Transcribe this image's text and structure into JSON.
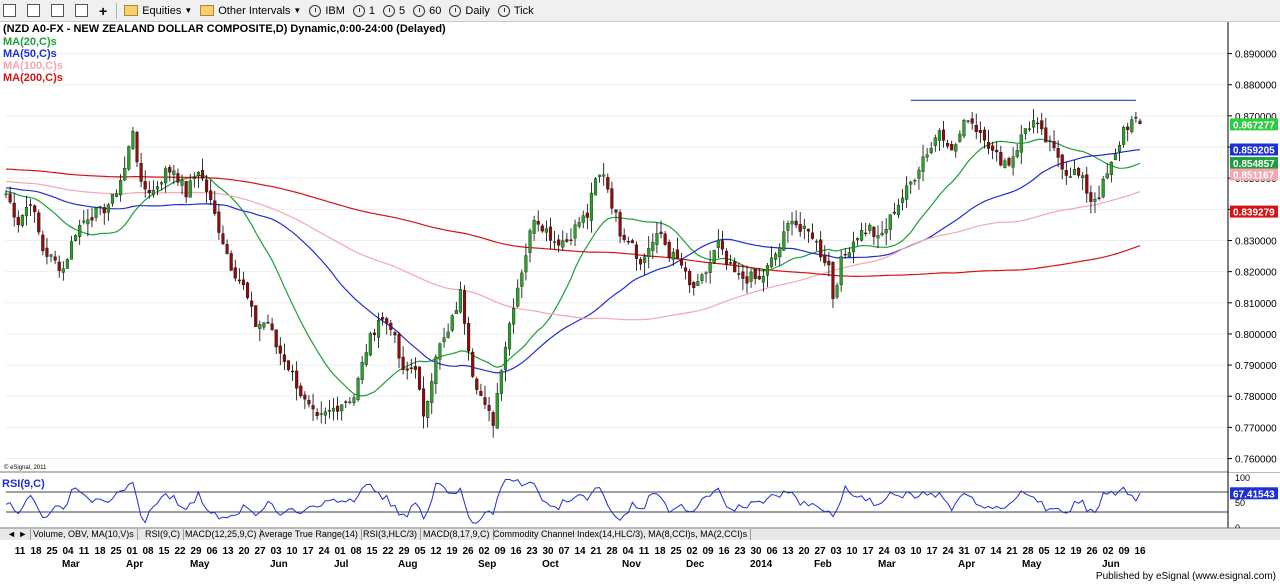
{
  "toolbar": {
    "items": [
      {
        "name": "pan-tool-icon"
      },
      {
        "name": "zoom-tool-icon"
      },
      {
        "name": "print-icon"
      },
      {
        "name": "properties-icon"
      },
      {
        "name": "crosshair-icon"
      }
    ],
    "equities_label": "Equities",
    "other_intervals_label": "Other Intervals",
    "intervals": [
      "IBM",
      "1",
      "5",
      "60",
      "Daily",
      "Tick"
    ]
  },
  "chart_header": {
    "title": "(NZD A0-FX - NEW ZEALAND DOLLAR COMPOSITE,D) Dynamic,0:00-24:00 (Delayed)",
    "studies": [
      {
        "label": "MA(20,C)s",
        "color": "#1e9e3c"
      },
      {
        "label": "MA(50,C)s",
        "color": "#1f2fd1"
      },
      {
        "label": "MA(100,C)s",
        "color": "#f4a7b2"
      },
      {
        "label": "MA(200,C)s",
        "color": "#d41414"
      }
    ],
    "copyright": "© eSignal, 2011"
  },
  "chart_data": {
    "type": "candlestick",
    "title": "(NZD A0-FX - NEW ZEALAND DOLLAR COMPOSITE,D) Dynamic,0:00-24:00 (Delayed)",
    "ylim": [
      0.756,
      0.895
    ],
    "y_ticks": [
      "0.890000",
      "0.880000",
      "0.870000",
      "0.860000",
      "0.850000",
      "0.840000",
      "0.830000",
      "0.820000",
      "0.810000",
      "0.800000",
      "0.790000",
      "0.780000",
      "0.770000",
      "0.760000"
    ],
    "price_flags": [
      {
        "label": "0.867277",
        "value": 0.867277,
        "color": "#2ecc40",
        "text_color": "#ffffff"
      },
      {
        "label": "0.859205",
        "value": 0.859205,
        "color": "#1f2fd1",
        "text_color": "#ffffff"
      },
      {
        "label": "0.854857",
        "value": 0.854857,
        "color": "#1e9e3c",
        "text_color": "#ffffff"
      },
      {
        "label": "0.851167",
        "value": 0.851167,
        "color": "#f4a7b2",
        "text_color": "#ffffff"
      },
      {
        "label": "0.839279",
        "value": 0.839279,
        "color": "#d41414",
        "text_color": "#ffffff"
      }
    ],
    "resistance_line": {
      "value": 0.875,
      "from_index": 221,
      "to_index": 276,
      "color": "#3040c0"
    },
    "x_day_labels": [
      "11",
      "18",
      "25",
      "04",
      "11",
      "18",
      "25",
      "01",
      "08",
      "15",
      "22",
      "29",
      "06",
      "13",
      "20",
      "27",
      "03",
      "10",
      "17",
      "24",
      "01",
      "08",
      "15",
      "22",
      "29",
      "05",
      "12",
      "19",
      "26",
      "02",
      "09",
      "16",
      "23",
      "30",
      "07",
      "14",
      "21",
      "28",
      "04",
      "11",
      "18",
      "25",
      "02",
      "09",
      "16",
      "23",
      "30",
      "06",
      "13",
      "20",
      "27",
      "03",
      "10",
      "17",
      "24",
      "03",
      "10",
      "17",
      "24",
      "31",
      "07",
      "14",
      "21",
      "28",
      "05",
      "12",
      "19",
      "26",
      "02",
      "09",
      "16"
    ],
    "x_month_labels": [
      {
        "label": "Mar",
        "index": 3
      },
      {
        "label": "Apr",
        "index": 7
      },
      {
        "label": "May",
        "index": 11
      },
      {
        "label": "Jun",
        "index": 16
      },
      {
        "label": "Jul",
        "index": 20
      },
      {
        "label": "Aug",
        "index": 24
      },
      {
        "label": "Sep",
        "index": 29
      },
      {
        "label": "Oct",
        "index": 33
      },
      {
        "label": "Nov",
        "index": 38
      },
      {
        "label": "Dec",
        "index": 42
      },
      {
        "label": "2014",
        "index": 46
      },
      {
        "label": "Feb",
        "index": 50
      },
      {
        "label": "Mar",
        "index": 54
      },
      {
        "label": "Apr",
        "index": 59
      },
      {
        "label": "May",
        "index": 63
      },
      {
        "label": "Jun",
        "index": 68
      }
    ],
    "close_anchors": [
      [
        0,
        0.845
      ],
      [
        3,
        0.836
      ],
      [
        6,
        0.843
      ],
      [
        9,
        0.827
      ],
      [
        12,
        0.823
      ],
      [
        14,
        0.821
      ],
      [
        17,
        0.833
      ],
      [
        20,
        0.838
      ],
      [
        23,
        0.839
      ],
      [
        26,
        0.843
      ],
      [
        29,
        0.853
      ],
      [
        31,
        0.866
      ],
      [
        33,
        0.847
      ],
      [
        36,
        0.846
      ],
      [
        39,
        0.852
      ],
      [
        41,
        0.853
      ],
      [
        44,
        0.845
      ],
      [
        47,
        0.853
      ],
      [
        49,
        0.846
      ],
      [
        51,
        0.838
      ],
      [
        53,
        0.83
      ],
      [
        55,
        0.822
      ],
      [
        58,
        0.815
      ],
      [
        61,
        0.803
      ],
      [
        64,
        0.804
      ],
      [
        66,
        0.796
      ],
      [
        68,
        0.792
      ],
      [
        70,
        0.787
      ],
      [
        73,
        0.778
      ],
      [
        76,
        0.772
      ],
      [
        79,
        0.775
      ],
      [
        82,
        0.778
      ],
      [
        85,
        0.78
      ],
      [
        88,
        0.795
      ],
      [
        91,
        0.805
      ],
      [
        94,
        0.803
      ],
      [
        97,
        0.787
      ],
      [
        100,
        0.79
      ],
      [
        102,
        0.772
      ],
      [
        105,
        0.794
      ],
      [
        108,
        0.8
      ],
      [
        111,
        0.813
      ],
      [
        114,
        0.788
      ],
      [
        117,
        0.776
      ],
      [
        119,
        0.772
      ],
      [
        121,
        0.79
      ],
      [
        124,
        0.81
      ],
      [
        127,
        0.826
      ],
      [
        129,
        0.838
      ],
      [
        131,
        0.835
      ],
      [
        134,
        0.83
      ],
      [
        137,
        0.83
      ],
      [
        140,
        0.836
      ],
      [
        142,
        0.838
      ],
      [
        144,
        0.849
      ],
      [
        146,
        0.852
      ],
      [
        148,
        0.842
      ],
      [
        150,
        0.833
      ],
      [
        153,
        0.83
      ],
      [
        155,
        0.822
      ],
      [
        157,
        0.828
      ],
      [
        160,
        0.832
      ],
      [
        162,
        0.826
      ],
      [
        165,
        0.822
      ],
      [
        167,
        0.815
      ],
      [
        169,
        0.815
      ],
      [
        171,
        0.82
      ],
      [
        174,
        0.829
      ],
      [
        176,
        0.822
      ],
      [
        179,
        0.818
      ],
      [
        182,
        0.818
      ],
      [
        184,
        0.817
      ],
      [
        186,
        0.821
      ],
      [
        189,
        0.828
      ],
      [
        192,
        0.838
      ],
      [
        194,
        0.833
      ],
      [
        197,
        0.832
      ],
      [
        199,
        0.826
      ],
      [
        201,
        0.822
      ],
      [
        202,
        0.812
      ],
      [
        204,
        0.823
      ],
      [
        206,
        0.828
      ],
      [
        208,
        0.832
      ],
      [
        211,
        0.834
      ],
      [
        213,
        0.83
      ],
      [
        215,
        0.834
      ],
      [
        217,
        0.84
      ],
      [
        220,
        0.846
      ],
      [
        222,
        0.851
      ],
      [
        224,
        0.857
      ],
      [
        226,
        0.86
      ],
      [
        228,
        0.866
      ],
      [
        230,
        0.862
      ],
      [
        231,
        0.858
      ],
      [
        233,
        0.864
      ],
      [
        235,
        0.87
      ],
      [
        237,
        0.866
      ],
      [
        239,
        0.864
      ],
      [
        241,
        0.858
      ],
      [
        243,
        0.856
      ],
      [
        245,
        0.855
      ],
      [
        247,
        0.86
      ],
      [
        249,
        0.866
      ],
      [
        251,
        0.868
      ],
      [
        253,
        0.864
      ],
      [
        255,
        0.86
      ],
      [
        257,
        0.857
      ],
      [
        259,
        0.852
      ],
      [
        261,
        0.852
      ],
      [
        263,
        0.849
      ],
      [
        265,
        0.843
      ],
      [
        267,
        0.845
      ],
      [
        269,
        0.851
      ],
      [
        271,
        0.857
      ],
      [
        273,
        0.866
      ],
      [
        275,
        0.868
      ],
      [
        277,
        0.867
      ]
    ],
    "rsi": {
      "label": "RSI(9,C)",
      "value_label": "67.41543",
      "value": 67.41543,
      "color": "#1f2fd1",
      "ylim": [
        0,
        100
      ],
      "levels": [
        70,
        30
      ],
      "y_ticks": [
        "100",
        "50",
        "0"
      ]
    }
  },
  "study_tabs": [
    "Volume, OBV, MA(10,V)s",
    "RSI(9,C)",
    "MACD(12,25,9,C)",
    "Average True Range(14)",
    "RSI(3,HLC/3)",
    "MACD(8,17,9,C)",
    "Commodity Channel Index(14,HLC/3), MA(8,CCI)s, MA(2,CCI)s"
  ],
  "footer": {
    "text": "Published by eSignal (www.esignal.com)"
  }
}
